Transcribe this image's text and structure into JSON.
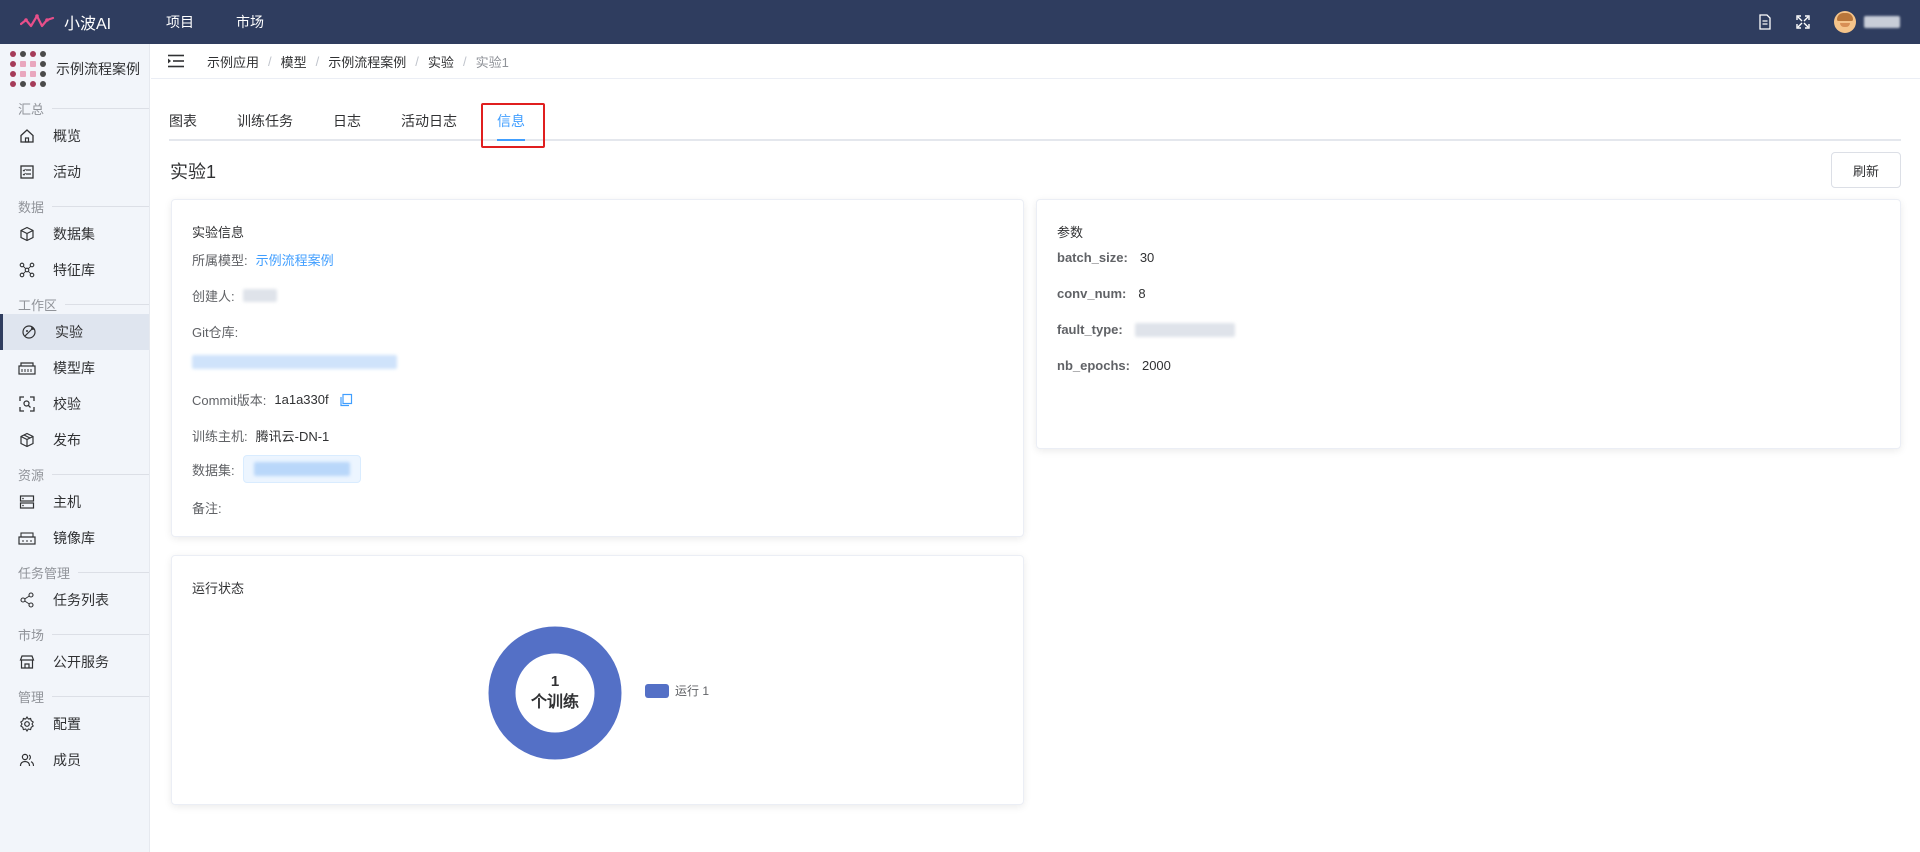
{
  "app": {
    "name": "小波AI"
  },
  "topnav": {
    "items": [
      "项目",
      "市场"
    ]
  },
  "project": {
    "name": "示例流程案例"
  },
  "sidebar": {
    "sections": [
      {
        "title": "汇总",
        "items": [
          {
            "label": "概览",
            "icon": "home-icon"
          },
          {
            "label": "活动",
            "icon": "activity-icon"
          }
        ]
      },
      {
        "title": "数据",
        "items": [
          {
            "label": "数据集",
            "icon": "cube-icon"
          },
          {
            "label": "特征库",
            "icon": "graph-icon"
          }
        ]
      },
      {
        "title": "工作区",
        "items": [
          {
            "label": "实验",
            "icon": "experiment-icon",
            "active": true
          },
          {
            "label": "模型库",
            "icon": "model-icon"
          },
          {
            "label": "校验",
            "icon": "scan-icon"
          },
          {
            "label": "发布",
            "icon": "package-icon"
          }
        ]
      },
      {
        "title": "资源",
        "items": [
          {
            "label": "主机",
            "icon": "server-icon"
          },
          {
            "label": "镜像库",
            "icon": "image-repo-icon"
          }
        ]
      },
      {
        "title": "任务管理",
        "items": [
          {
            "label": "任务列表",
            "icon": "tasks-icon"
          }
        ]
      },
      {
        "title": "市场",
        "items": [
          {
            "label": "公开服务",
            "icon": "store-icon"
          }
        ]
      },
      {
        "title": "管理",
        "items": [
          {
            "label": "配置",
            "icon": "settings-icon"
          },
          {
            "label": "成员",
            "icon": "members-icon"
          }
        ]
      }
    ]
  },
  "breadcrumb": [
    "示例应用",
    "模型",
    "示例流程案例",
    "实验",
    "实验1"
  ],
  "tabs": [
    "图表",
    "训练任务",
    "日志",
    "活动日志",
    "信息"
  ],
  "active_tab": "信息",
  "page": {
    "title": "实验1",
    "refresh_label": "刷新"
  },
  "info_card": {
    "title": "实验信息",
    "model_label": "所属模型:",
    "model_value": "示例流程案例",
    "creator_label": "创建人:",
    "git_label": "Git仓库:",
    "commit_label": "Commit版本:",
    "commit_value": "1a1a330f",
    "host_label": "训练主机:",
    "host_value": "腾讯云-DN-1",
    "dataset_label": "数据集:",
    "note_label": "备注:"
  },
  "params_card": {
    "title": "参数",
    "params": [
      {
        "key": "batch_size:",
        "value": "30"
      },
      {
        "key": "conv_num:",
        "value": "8"
      },
      {
        "key": "fault_type:",
        "value": ""
      },
      {
        "key": "nb_epochs:",
        "value": "2000"
      }
    ]
  },
  "status_card": {
    "title": "运行状态",
    "center_count": "1",
    "center_text": "个训练",
    "legend_label": "运行 1",
    "color": "#5470c6"
  },
  "chart_data": {
    "type": "pie",
    "categories": [
      "运行"
    ],
    "values": [
      1
    ],
    "title": "运行状态"
  }
}
